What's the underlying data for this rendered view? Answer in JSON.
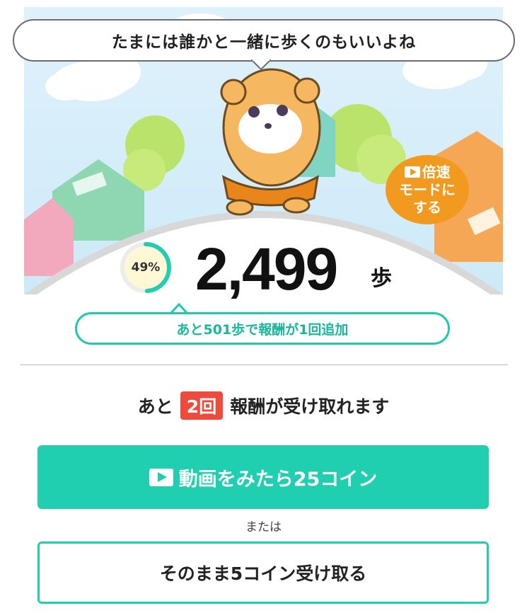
{
  "scene": {
    "speech_text": "たまには誰かと一緒に歩くのもいいよね",
    "speed_mode": {
      "line1": "倍速",
      "line2": "モードに",
      "line3": "する"
    }
  },
  "progress": {
    "percent_label": "49%",
    "fraction": 0.49,
    "steps": "2,499",
    "unit": "歩",
    "hint": "あと501歩で報酬が1回追加"
  },
  "rewards": {
    "prefix": "あと",
    "count": "2回",
    "suffix": "報酬が受け取れます",
    "video_button": "動画をみたら25コイン",
    "or": "または",
    "plain_button": "そのまま5コイン受け取る"
  },
  "colors": {
    "accent": "#1fcfb0",
    "badge_red": "#ef4a3c",
    "speed_orange": "#f29a1f"
  }
}
